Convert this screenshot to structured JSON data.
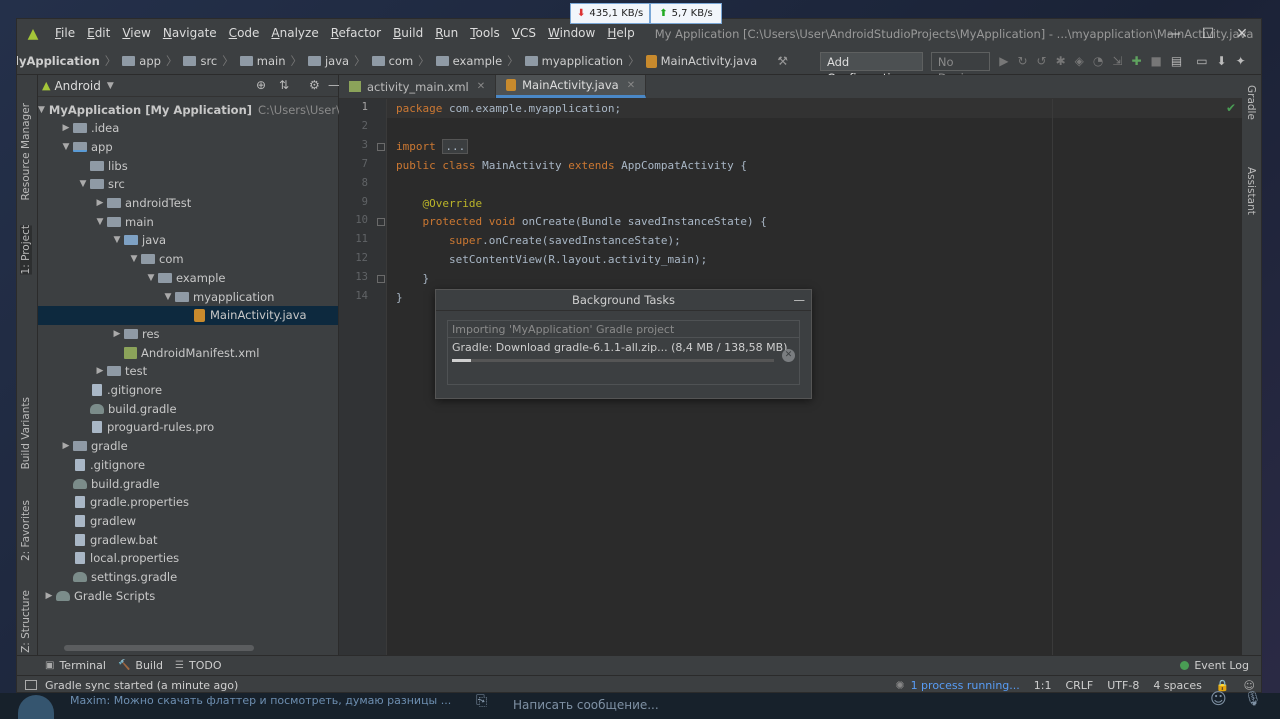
{
  "net_speed": {
    "download": "435,1 KB/s",
    "upload": "5,7 KB/s"
  },
  "menu": [
    "File",
    "Edit",
    "View",
    "Navigate",
    "Code",
    "Analyze",
    "Refactor",
    "Build",
    "Run",
    "Tools",
    "VCS",
    "Window",
    "Help"
  ],
  "window_title": "My Application [C:\\Users\\User\\AndroidStudioProjects\\MyApplication] - ...\\myapplication\\MainActivity.java",
  "breadcrumbs": [
    "lyApplication",
    "app",
    "src",
    "main",
    "java",
    "com",
    "example",
    "myapplication",
    "MainActivity.java"
  ],
  "toolbar": {
    "add_configuration": "Add Configuration...",
    "devices": "No Devices"
  },
  "left_tabs": [
    "Resource Manager",
    "1: Project",
    "Build Variants",
    "2: Favorites",
    "Z: Structure"
  ],
  "right_tabs": [
    "Gradle",
    "Assistant"
  ],
  "project_panel": {
    "view": "Android",
    "tree": [
      {
        "label": "MyApplication [My Application]",
        "extra": "C:\\Users\\User\\Andro",
        "depth": 0,
        "arrow": "▼",
        "icon": "module",
        "bold": true
      },
      {
        "label": ".idea",
        "depth": 1,
        "arrow": "▶",
        "icon": "folder"
      },
      {
        "label": "app",
        "depth": 1,
        "arrow": "▼",
        "icon": "module"
      },
      {
        "label": "libs",
        "depth": 2,
        "arrow": "",
        "icon": "folder"
      },
      {
        "label": "src",
        "depth": 2,
        "arrow": "▼",
        "icon": "folder"
      },
      {
        "label": "androidTest",
        "depth": 3,
        "arrow": "▶",
        "icon": "folder"
      },
      {
        "label": "main",
        "depth": 3,
        "arrow": "▼",
        "icon": "folder"
      },
      {
        "label": "java",
        "depth": 4,
        "arrow": "▼",
        "icon": "folder-blue"
      },
      {
        "label": "com",
        "depth": 5,
        "arrow": "▼",
        "icon": "folder"
      },
      {
        "label": "example",
        "depth": 6,
        "arrow": "▼",
        "icon": "folder"
      },
      {
        "label": "myapplication",
        "depth": 7,
        "arrow": "▼",
        "icon": "folder"
      },
      {
        "label": "MainActivity.java",
        "depth": 8,
        "arrow": "",
        "icon": "java",
        "selected": true
      },
      {
        "label": "res",
        "depth": 4,
        "arrow": "▶",
        "icon": "folder"
      },
      {
        "label": "AndroidManifest.xml",
        "depth": 4,
        "arrow": "",
        "icon": "xml"
      },
      {
        "label": "test",
        "depth": 3,
        "arrow": "▶",
        "icon": "folder"
      },
      {
        "label": ".gitignore",
        "depth": 2,
        "arrow": "",
        "icon": "file"
      },
      {
        "label": "build.gradle",
        "depth": 2,
        "arrow": "",
        "icon": "gradle"
      },
      {
        "label": "proguard-rules.pro",
        "depth": 2,
        "arrow": "",
        "icon": "file"
      },
      {
        "label": "gradle",
        "depth": 1,
        "arrow": "▶",
        "icon": "folder"
      },
      {
        "label": ".gitignore",
        "depth": 1,
        "arrow": "",
        "icon": "file"
      },
      {
        "label": "build.gradle",
        "depth": 1,
        "arrow": "",
        "icon": "gradle"
      },
      {
        "label": "gradle.properties",
        "depth": 1,
        "arrow": "",
        "icon": "file"
      },
      {
        "label": "gradlew",
        "depth": 1,
        "arrow": "",
        "icon": "file"
      },
      {
        "label": "gradlew.bat",
        "depth": 1,
        "arrow": "",
        "icon": "file"
      },
      {
        "label": "local.properties",
        "depth": 1,
        "arrow": "",
        "icon": "file"
      },
      {
        "label": "settings.gradle",
        "depth": 1,
        "arrow": "",
        "icon": "gradle"
      },
      {
        "label": "Gradle Scripts",
        "depth": 0,
        "arrow": "▶",
        "icon": "gradle"
      }
    ]
  },
  "editor_tabs": [
    {
      "label": "activity_main.xml",
      "type": "xml",
      "active": false
    },
    {
      "label": "MainActivity.java",
      "type": "java",
      "active": true
    }
  ],
  "code_lines": [
    {
      "n": "1",
      "html": "<span class=\"kw\">package</span> com.example.myapplication;"
    },
    {
      "n": "2",
      "html": ""
    },
    {
      "n": "3",
      "html": "<span class=\"kw\">import</span> <span class=\"fold-box\">...</span>"
    },
    {
      "n": "7",
      "html": "<span class=\"kw\">public class</span> MainActivity <span class=\"kw\">extends</span> AppCompatActivity {"
    },
    {
      "n": "8",
      "html": ""
    },
    {
      "n": "9",
      "html": "    <span class=\"ann\">@Override</span>"
    },
    {
      "n": "10",
      "html": "    <span class=\"kw\">protected void</span> onCreate(Bundle savedInstanceState) {"
    },
    {
      "n": "11",
      "html": "        <span class=\"kw\">super</span>.onCreate(savedInstanceState);"
    },
    {
      "n": "12",
      "html": "        setContentView(R.layout.activity_main);"
    },
    {
      "n": "13",
      "html": "    }"
    },
    {
      "n": "14",
      "html": "}"
    }
  ],
  "background_tasks": {
    "title": "Background Tasks",
    "task_title": "Importing 'MyApplication' Gradle project",
    "task_detail": "Gradle: Download gradle-6.1.1-all.zip...  (8,4 MB / 138,58 MB)",
    "progress": 0.06
  },
  "bottom_tools": [
    {
      "label": "Terminal",
      "icon": "▣"
    },
    {
      "label": "Build",
      "icon": "🔨"
    },
    {
      "label": "TODO",
      "icon": "☰"
    }
  ],
  "event_log": "Event Log",
  "status": {
    "message": "Gradle sync started (a minute ago)",
    "process": "1 process running...",
    "position": "1:1",
    "line_sep": "CRLF",
    "encoding": "UTF-8",
    "indent": "4 spaces"
  },
  "telegram": {
    "preview": "Maxim: Можно скачать флаттер и посмотреть, думаю разницы ...",
    "compose_placeholder": "Написать сообщение..."
  }
}
